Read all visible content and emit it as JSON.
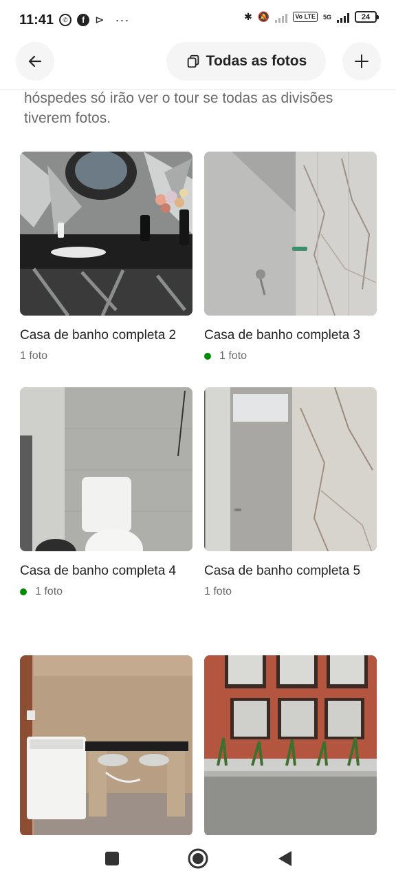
{
  "status_bar": {
    "time": "11:41",
    "left_icons": [
      "whatsapp-icon",
      "facebook-icon",
      "play-icon"
    ],
    "dots": "···",
    "network": "5G",
    "volte": "Vo LTE",
    "battery": "24"
  },
  "header": {
    "back_icon": "arrow-left-icon",
    "all_photos_label": "Todas as fotos",
    "all_photos_icon": "copy-icon",
    "add_icon": "plus-icon"
  },
  "intro_text": "hóspedes só irão ver o tour se todas as divisões tiverem fotos.",
  "rooms": [
    {
      "title": "Casa de banho completa 2",
      "count": "1 foto",
      "status_dot": false
    },
    {
      "title": "Casa de banho completa 3",
      "count": "1 foto",
      "status_dot": true
    },
    {
      "title": "Casa de banho completa 4",
      "count": "1 foto",
      "status_dot": true
    },
    {
      "title": "Casa de banho completa 5",
      "count": "1 foto",
      "status_dot": false
    },
    {
      "title": "",
      "count": "",
      "status_dot": false
    },
    {
      "title": "",
      "count": "",
      "status_dot": false
    }
  ],
  "colors": {
    "accent_green": "#008a05",
    "text_primary": "#222222",
    "text_secondary": "#6a6a6a",
    "button_bg": "#f5f5f5"
  },
  "nav_bar": {
    "icons": [
      "recents-square-icon",
      "home-circle-icon",
      "back-triangle-icon"
    ]
  }
}
